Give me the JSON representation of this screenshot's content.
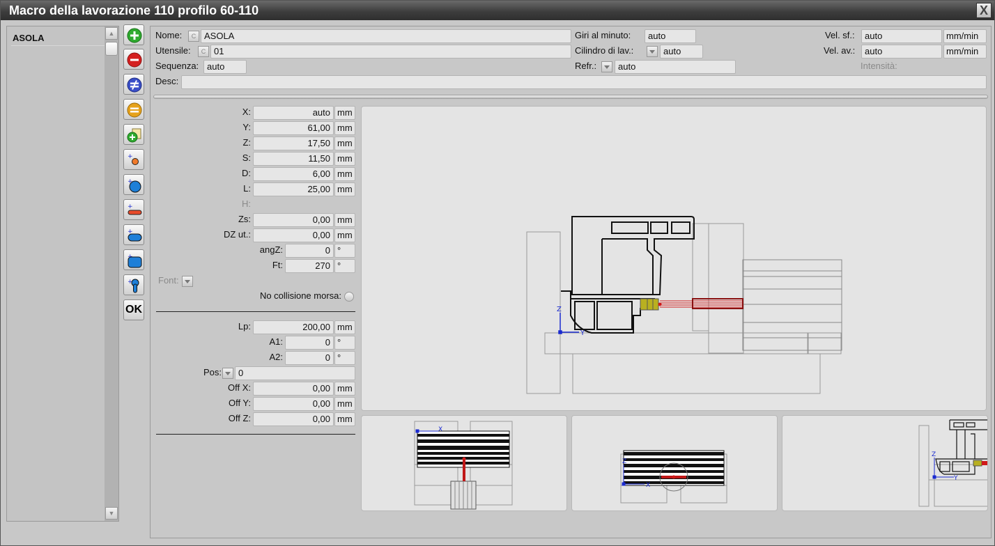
{
  "window": {
    "title": "Macro della lavorazione 110 profilo 60-110",
    "close_label": "X"
  },
  "list": {
    "items": [
      "ASOLA"
    ]
  },
  "toolbar": {
    "ok_label": "OK"
  },
  "header": {
    "nome_label": "Nome:",
    "nome_value": "ASOLA",
    "utensile_label": "Utensile:",
    "utensile_value": "01",
    "sequenza_label": "Sequenza:",
    "sequenza_value": "auto",
    "desc_label": "Desc:",
    "desc_value": "",
    "giri_label": "Giri al minuto:",
    "giri_value": "auto",
    "cilindro_label": "Cilindro di lav.:",
    "cilindro_value": "auto",
    "refr_label": "Refr.:",
    "refr_value": "auto",
    "velsf_label": "Vel. sf.:",
    "velsf_value": "auto",
    "velsf_unit": "mm/min",
    "velav_label": "Vel. av.:",
    "velav_value": "auto",
    "velav_unit": "mm/min",
    "intensita_label": "Intensità:",
    "c_button": "C"
  },
  "params": {
    "x_label": "X:",
    "x_value": "auto",
    "y_label": "Y:",
    "y_value": "61,00",
    "z_label": "Z:",
    "z_value": "17,50",
    "s_label": "S:",
    "s_value": "11,50",
    "d_label": "D:",
    "d_value": "6,00",
    "l_label": "L:",
    "l_value": "25,00",
    "h_label": "H:",
    "zs_label": "Zs:",
    "zs_value": "0,00",
    "dzut_label": "DZ ut.:",
    "dzut_value": "0,00",
    "angz_label": "angZ:",
    "angz_value": "0",
    "ft_label": "Ft:",
    "ft_value": "270",
    "font_label": "Font:",
    "nocoll_label": "No collisione morsa:",
    "lp_label": "Lp:",
    "lp_value": "200,00",
    "a1_label": "A1:",
    "a1_value": "0",
    "a2_label": "A2:",
    "a2_value": "0",
    "pos_label": "Pos:",
    "pos_value": "0",
    "offx_label": "Off X:",
    "offx_value": "0,00",
    "offy_label": "Off Y:",
    "offy_value": "0,00",
    "offz_label": "Off Z:",
    "offz_value": "0,00",
    "unit_mm": "mm",
    "unit_deg": "°"
  },
  "views": {
    "axis_z": "Z",
    "axis_y": "Y",
    "axis_x": "X"
  },
  "colors": {
    "add": "#2faa2f",
    "remove": "#d42020",
    "diff": "#3a4fc8",
    "equal": "#e6a21c",
    "tool_red": "#d01a1a",
    "axis_blue": "#1a2ad0"
  }
}
